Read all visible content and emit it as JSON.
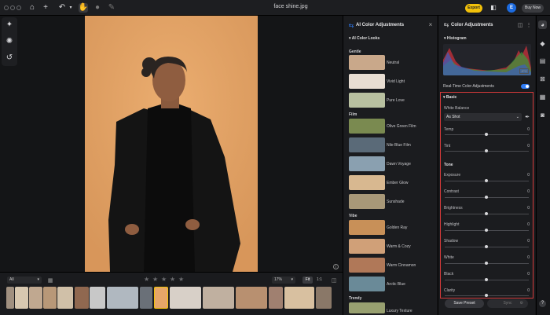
{
  "window": {
    "title": "face shine.jpg"
  },
  "toolbar": {
    "export_label": "Export",
    "avatar_initial": "E",
    "buy_now_label": "Buy Now"
  },
  "ai_panel": {
    "title": "AI Color Adjustments",
    "looks_header": "AI Color Looks",
    "sections": [
      {
        "name": "Gentle",
        "items": [
          "Neutral",
          "Vivid Light",
          "Pure Love"
        ]
      },
      {
        "name": "Film",
        "items": [
          "Olive Green Film",
          "Nile Blue Film",
          "Dawn Voyage",
          "Ember Glow",
          "Sunshade"
        ]
      },
      {
        "name": "Vibe",
        "items": [
          "Golden Ray",
          "Warm & Cozy",
          "Warm Cinnamon",
          "Arctic Blue"
        ]
      },
      {
        "name": "Trendy",
        "items": [
          "Luxury Texture"
        ]
      }
    ]
  },
  "color_panel": {
    "title": "Color Adjustments",
    "histogram_label": "Histogram",
    "histogram_badge": "JPG",
    "realtime_label": "Real-Time Color Adjustments",
    "realtime_on": true,
    "basic_label": "Basic",
    "white_balance_label": "White Balance",
    "white_balance_value": "As Shot",
    "tone_label": "Tone",
    "sliders_wb": [
      {
        "label": "Temp",
        "value": "0"
      },
      {
        "label": "Tint",
        "value": "0"
      }
    ],
    "sliders_tone": [
      {
        "label": "Exposure",
        "value": "0"
      },
      {
        "label": "Contrast",
        "value": "0"
      },
      {
        "label": "Brightness",
        "value": "0"
      },
      {
        "label": "Highlight",
        "value": "0"
      },
      {
        "label": "Shadow",
        "value": "0"
      },
      {
        "label": "White",
        "value": "0"
      },
      {
        "label": "Black",
        "value": "0"
      },
      {
        "label": "Clarity",
        "value": "0"
      }
    ],
    "save_preset_label": "Save Preset",
    "sync_label": "Sync"
  },
  "filmstrip": {
    "filter_value": "All",
    "zoom_value": "17%",
    "fit_label": "Fit",
    "one_to_one_label": "1:1",
    "rating": 0
  },
  "colors": {
    "accent_yellow": "#f2c10a",
    "accent_blue": "#2f7cf6",
    "highlight_red": "#d43a3a"
  }
}
